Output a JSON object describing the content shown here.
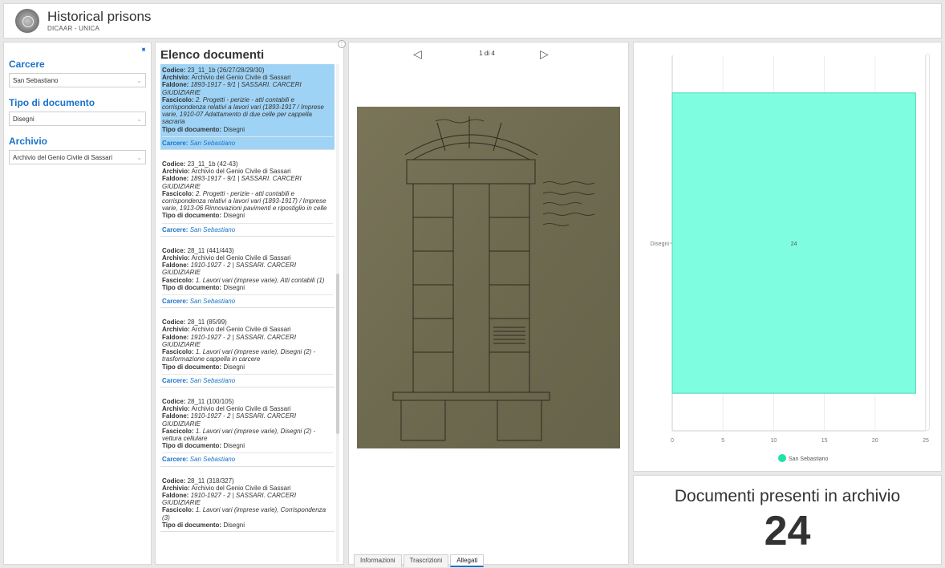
{
  "header": {
    "title": "Historical prisons",
    "subtitle": "DICAAR - UNICA"
  },
  "filters": {
    "carcere_label": "Carcere",
    "carcere_value": "San Sebastiano",
    "tipo_label": "Tipo di documento",
    "tipo_value": "Disegni",
    "archivio_label": "Archivio",
    "archivio_value": "Archivio del Genio Civile di Sassari"
  },
  "list": {
    "title": "Elenco documenti",
    "field_labels": {
      "codice": "Codice:",
      "archivio": "Archivio:",
      "faldone": "Faldone:",
      "fascicolo": "Fascicolo:",
      "tipo": "Tipo di documento:",
      "carcere": "Carcere:"
    },
    "items": [
      {
        "codice": "23_11_1b (26/27/28/29/30)",
        "archivio": "Archivio del Genio Civile di Sassari",
        "faldone": "1893-1917 - 9/1 | SASSARI. CARCERI GIUDIZIARIE",
        "fascicolo": "2. Progetti - perizie - atti contabili e corrispondenza relativi a lavori vari (1893-1917 / Imprese varie, 1910-07 Adattamento di due celle per cappella sacraria",
        "tipo": "Disegni",
        "carcere": "San Sebastiano"
      },
      {
        "codice": "23_11_1b (42-43)",
        "archivio": "Archivio del Genio Civile di Sassari",
        "faldone": "1893-1917 - 9/1 | SASSARI. CARCERI GIUDIZIARIE",
        "fascicolo": "2. Progetti - perizie - atti contabili e corrispondenza relativi a lavori vari (1893-1917) / Imprese varie, 1913-06 Rinnovazioni pavimenti e ripostiglio in celle",
        "tipo": "Disegni",
        "carcere": "San Sebastiano"
      },
      {
        "codice": "28_11 (441/443)",
        "archivio": "Archivio del Genio Civile di Sassari",
        "faldone": "1910-1927 - 2 | SASSARI. CARCERI GIUDIZIARIE",
        "fascicolo": "1. Lavori vari (imprese varie), Atti contabili (1)",
        "tipo": "Disegni",
        "carcere": "San Sebastiano"
      },
      {
        "codice": "28_11 (85/99)",
        "archivio": "Archivio del Genio Civile di Sassari",
        "faldone": "1910-1927 - 2 | SASSARI. CARCERI GIUDIZIARIE",
        "fascicolo": "1. Lavori vari (imprese varie), Disegni (2) - trasformazione cappella in carcere",
        "tipo": "Disegni",
        "carcere": "San Sebastiano"
      },
      {
        "codice": "28_11 (100/105)",
        "archivio": "Archivio del Genio Civile di Sassari",
        "faldone": "1910-1927 - 2 | SASSARI. CARCERI GIUDIZIARIE",
        "fascicolo": "1. Lavori vari (imprese varie), Disegni (2) - vettura cellulare",
        "tipo": "Disegni",
        "carcere": "San Sebastiano"
      },
      {
        "codice": "28_11 (318/327)",
        "archivio": "Archivio del Genio Civile di Sassari",
        "faldone": "1910-1927 - 2 | SASSARI. CARCERI GIUDIZIARIE",
        "fascicolo": "1. Lavori vari (imprese varie), Corrispondenza (3)",
        "tipo": "Disegni",
        "carcere": ""
      }
    ]
  },
  "viewer": {
    "counter": "1 di 4",
    "prev_icon": "chevron-left-icon",
    "next_icon": "chevron-right-icon",
    "tabs": [
      "Informazioni",
      "Trascrizioni",
      "Allegati"
    ],
    "active_tab": "Allegati"
  },
  "chart_data": {
    "type": "bar",
    "orientation": "horizontal",
    "categories": [
      "Disegni"
    ],
    "series": [
      {
        "name": "San Sebastiano",
        "values": [
          24
        ],
        "color": "#7ffde0"
      }
    ],
    "data_labels": [
      "24"
    ],
    "xlim": [
      0,
      25
    ],
    "xticks": [
      0,
      5,
      10,
      15,
      20,
      25
    ],
    "grid": true,
    "legend": "bottom"
  },
  "indicator": {
    "title": "Documenti presenti in archivio",
    "value": "24"
  },
  "colors": {
    "accent": "#1a73c9",
    "selected_row": "#9fd3f5",
    "bar_fill": "#7ffde0",
    "bar_stroke": "#47d9b4",
    "legend_dot": "#1ee3a9"
  }
}
